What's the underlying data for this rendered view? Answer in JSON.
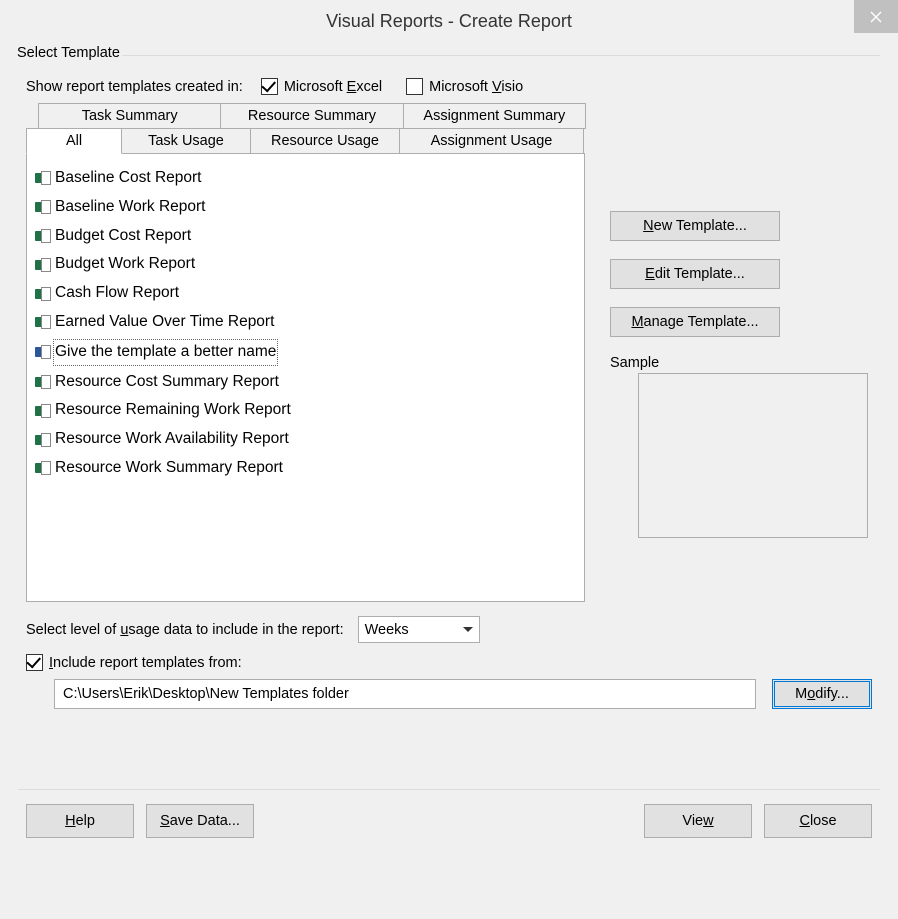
{
  "title": "Visual Reports - Create Report",
  "group_label": "Select Template",
  "show_label_pre": "Show report templates created in:",
  "excel_pre": "Microsoft ",
  "excel_u": "E",
  "excel_post": "xcel",
  "visio_pre": "Microsoft ",
  "visio_u": "V",
  "visio_post": "isio",
  "excel_checked": true,
  "visio_checked": false,
  "tabs_top": [
    "Task Summary",
    "Resource Summary",
    "Assignment Summary"
  ],
  "tabs_bottom": [
    "All",
    "Task Usage",
    "Resource Usage",
    "Assignment Usage"
  ],
  "active_tab": "All",
  "templates": [
    "Baseline Cost Report",
    "Baseline Work Report",
    "Budget Cost Report",
    "Budget Work Report",
    "Cash Flow Report",
    "Earned Value Over Time Report",
    "Give the template a better name",
    "Resource Cost Summary Report",
    "Resource Remaining Work Report",
    "Resource Work Availability Report",
    "Resource Work Summary Report"
  ],
  "selected_template_index": 6,
  "visio_template_index": 6,
  "new_template_u": "N",
  "new_template_post": "ew Template...",
  "edit_template_pre": "",
  "edit_template_u": "E",
  "edit_template_post": "dit Template...",
  "manage_template_u": "M",
  "manage_template_post": "anage Template...",
  "sample_label": "Sample",
  "usage_label_pre": "Select level of ",
  "usage_label_u": "u",
  "usage_label_post": "sage data to include in the report:",
  "usage_value": "Weeks",
  "include_u": "I",
  "include_post": "nclude report templates from:",
  "include_checked": true,
  "path_value": "C:\\Users\\Erik\\Desktop\\New Templates folder",
  "modify_pre": "M",
  "modify_u": "o",
  "modify_post": "dify...",
  "help_u": "H",
  "help_post": "elp",
  "save_u": "S",
  "save_post": "ave Data...",
  "view_pre": "Vie",
  "view_u": "w",
  "close_pre": "",
  "close_u": "C",
  "close_post": "lose"
}
